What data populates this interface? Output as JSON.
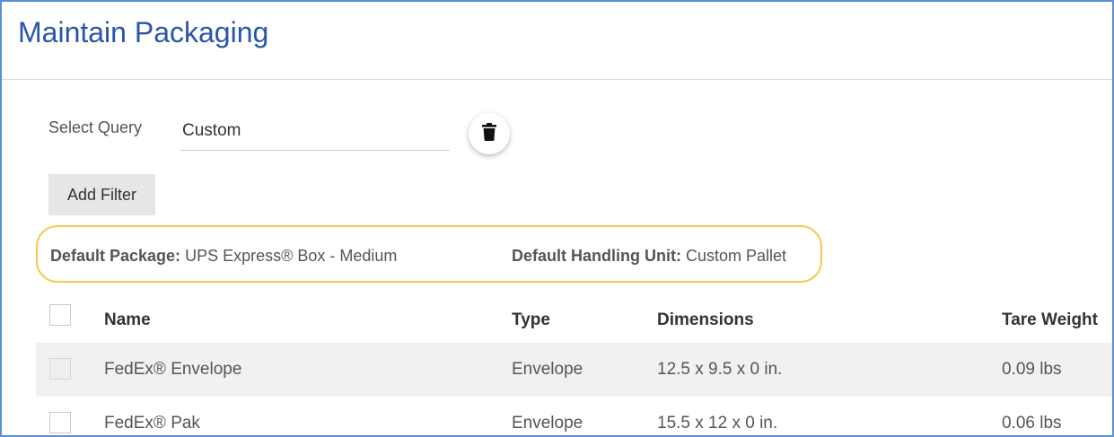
{
  "page": {
    "title": "Maintain Packaging"
  },
  "query": {
    "label": "Select Query",
    "value": "Custom"
  },
  "toolbar": {
    "add_filter_label": "Add Filter",
    "delete_icon": "trash-icon"
  },
  "defaults": {
    "package_label": "Default Package:",
    "package_value": "UPS Express® Box - Medium",
    "handling_label": "Default Handling Unit:",
    "handling_value": "Custom Pallet",
    "highlight_color": "#f2cb4f"
  },
  "table": {
    "columns": [
      "Name",
      "Type",
      "Dimensions",
      "Tare Weight"
    ],
    "rows": [
      {
        "name": "FedEx® Envelope",
        "type": "Envelope",
        "dimensions": "12.5 x 9.5 x 0 in.",
        "tare_weight": "0.09 lbs"
      },
      {
        "name": "FedEx® Pak",
        "type": "Envelope",
        "dimensions": "15.5 x 12 x 0 in.",
        "tare_weight": "0.06 lbs"
      }
    ]
  },
  "colors": {
    "title": "#2a55a8",
    "frame_border": "#5b8fd6",
    "row_alt": "#f1f1f1"
  }
}
